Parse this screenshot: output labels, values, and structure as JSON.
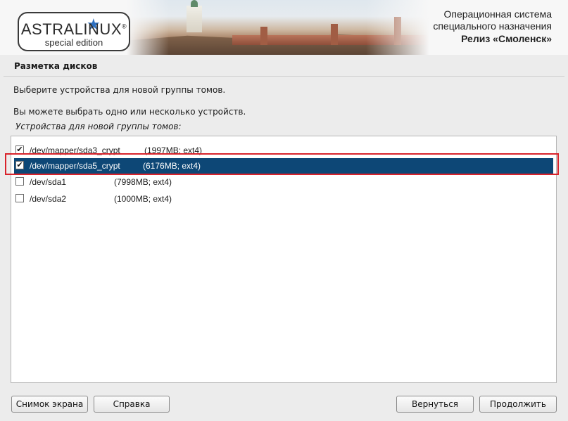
{
  "header": {
    "logo_name": "ASTRALINUX",
    "logo_trademark": "®",
    "logo_subtitle": "special edition",
    "os_line1": "Операционная система",
    "os_line2": "специального назначения",
    "os_release": "Релиз «Смоленск»"
  },
  "page": {
    "title": "Разметка дисков",
    "instruction": "Выберите устройства для новой группы томов.",
    "hint": "Вы можете выбрать одно или несколько устройств.",
    "list_caption": "Устройства для новой группы томов:"
  },
  "devices": [
    {
      "device": "/dev/mapper/sda3_crypt",
      "info": "(1997MB; ext4)",
      "checked": true,
      "selected": false
    },
    {
      "device": "/dev/mapper/sda5_crypt",
      "info": "(6176MB; ext4)",
      "checked": true,
      "selected": true
    },
    {
      "device": "/dev/sda1",
      "info": "(7998MB; ext4)",
      "checked": false,
      "selected": false
    },
    {
      "device": "/dev/sda2",
      "info": "(1000MB; ext4)",
      "checked": false,
      "selected": false
    }
  ],
  "checkbox_mark": "✔",
  "buttons": {
    "screenshot": "Снимок экрана",
    "help": "Справка",
    "back": "Вернуться",
    "continue": "Продолжить"
  },
  "colors": {
    "selection": "#0d4776",
    "highlight_frame": "#d9232b",
    "logo_star": "#2d6fc0"
  }
}
